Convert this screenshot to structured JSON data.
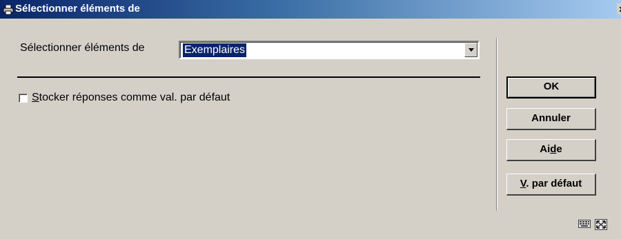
{
  "window": {
    "title": "Sélectionner éléments de",
    "close_glyph": "x"
  },
  "form": {
    "select_label": "Sélectionner éléments de",
    "select_value": "Exemplaires",
    "checkbox_label_mnemonic": "S",
    "checkbox_label_rest": "tocker réponses comme val. par défaut",
    "checkbox_checked": false
  },
  "buttons": {
    "ok": "OK",
    "cancel": "Annuler",
    "help_pre": "Ai",
    "help_mnemonic": "d",
    "help_post": "e",
    "defaults_mnemonic": "V",
    "defaults_rest": ". par défaut"
  },
  "icons": {
    "app": "printer-icon",
    "select_arrow": "chevron-down-icon",
    "status_left": "keyboard-icon",
    "status_right": "resize-grip-icon"
  },
  "colors": {
    "dialog_bg": "#d4d0c8",
    "title_start": "#0a246a",
    "title_end": "#a6caf0",
    "selection": "#0a246a"
  }
}
